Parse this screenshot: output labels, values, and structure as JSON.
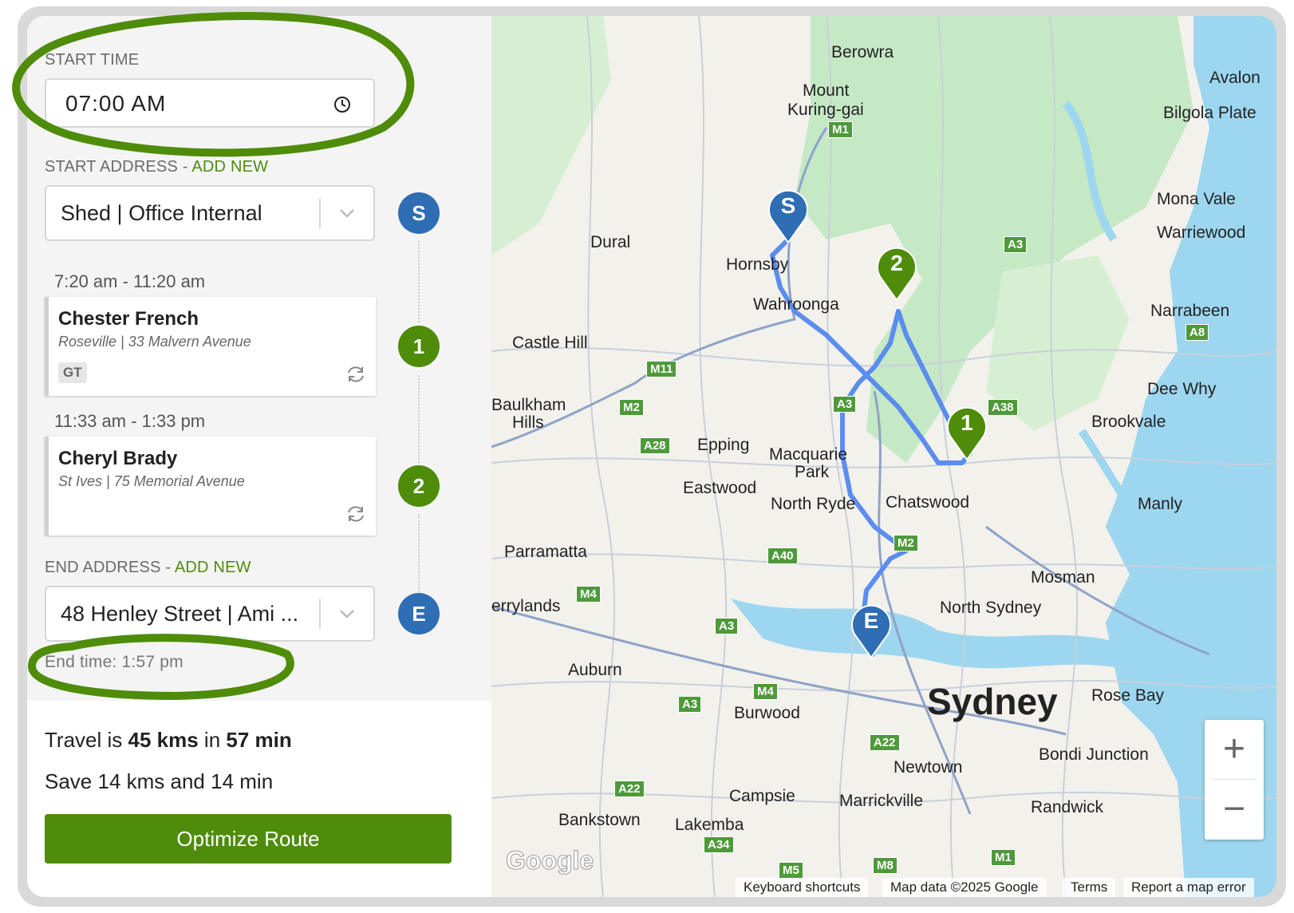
{
  "start_time": {
    "label": "START TIME",
    "value": "07:00  AM"
  },
  "start_address": {
    "label": "START ADDRESS - ",
    "add_new": "ADD NEW",
    "value": "Shed | Office Internal",
    "badge": "S"
  },
  "stops": [
    {
      "time": "7:20 am - 11:20 am",
      "name": "Chester French",
      "address": "Roseville | 33 Malvern Avenue",
      "tag": "GT",
      "badge": "1"
    },
    {
      "time": "11:33 am - 1:33 pm",
      "name": "Cheryl Brady",
      "address": "St Ives | 75 Memorial Avenue",
      "tag": "",
      "badge": "2"
    }
  ],
  "end_address": {
    "label": "END ADDRESS - ",
    "add_new": "ADD NEW",
    "value": "48 Henley Street | Ami ...",
    "badge": "E",
    "end_time": "End time: 1:57 pm"
  },
  "summary": {
    "travel_prefix": "Travel is ",
    "distance": "45 kms",
    "travel_mid": " in ",
    "duration": "57 min",
    "save": "Save 14 kms and 14 min",
    "optimize_label": "Optimize Route"
  },
  "map": {
    "places": [
      "Berowra",
      "Mount",
      "Kuring-gai",
      "Avalon",
      "Bilgola Plate",
      "Mona Vale",
      "Warriewood",
      "Dural",
      "Hornsby",
      "Wahroonga",
      "Narrabeen",
      "Castle Hill",
      "Dee Why",
      "Brookvale",
      "Baulkham",
      "Hills",
      "Epping",
      "Macquarie",
      "Park",
      "Eastwood",
      "North Ryde",
      "Chatswood",
      "Manly",
      "Parramatta",
      "Mosman",
      "errylands",
      "North Sydney",
      "Auburn",
      "Sydney",
      "Rose Bay",
      "Burwood",
      "Bondi Junction",
      "Newtown",
      "Campsie",
      "Marrickville",
      "Randwick",
      "Bankstown",
      "Lakemba"
    ],
    "shields": [
      "M1",
      "A3",
      "A8",
      "A38",
      "M11",
      "M2",
      "A28",
      "A3",
      "M2",
      "A40",
      "M4",
      "A3",
      "M4",
      "A3",
      "A22",
      "A22",
      "A34",
      "M8",
      "M1",
      "M5"
    ],
    "pins": [
      "S",
      "2",
      "1",
      "E"
    ],
    "zoom_in": "+",
    "zoom_out": "−",
    "google_logo": "Google",
    "attribution": [
      "Keyboard shortcuts",
      "Map data ©2025 Google",
      "Terms",
      "Report a map error"
    ],
    "colors": {
      "route": "#5b8def",
      "blue_pin": "#2f6db5",
      "green_pin": "#4e8c0a",
      "park": "#c5e8c5",
      "water": "#9dd6ef"
    }
  }
}
